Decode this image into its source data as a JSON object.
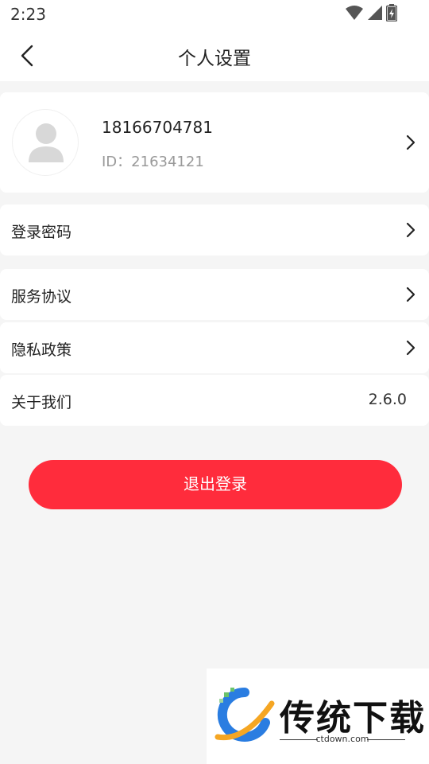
{
  "status_bar": {
    "time": "2:23",
    "icons": [
      "wifi-icon",
      "signal-icon",
      "battery-charging-icon"
    ]
  },
  "nav": {
    "back_icon": "chevron-left-icon",
    "title": "个人设置"
  },
  "profile": {
    "phone": "18166704781",
    "id_label": "ID：21634121",
    "avatar_icon": "user-placeholder-icon"
  },
  "menu": {
    "password": "登录密码",
    "service": "服务协议",
    "privacy": "隐私政策",
    "about": "关于我们",
    "about_value": "2.6.0"
  },
  "logout_label": "退出登录",
  "watermark": {
    "text": "传统下载",
    "url": "ctdown.com"
  },
  "colors": {
    "accent": "#ff2c3c",
    "background": "#f5f5f5",
    "card": "#ffffff"
  }
}
